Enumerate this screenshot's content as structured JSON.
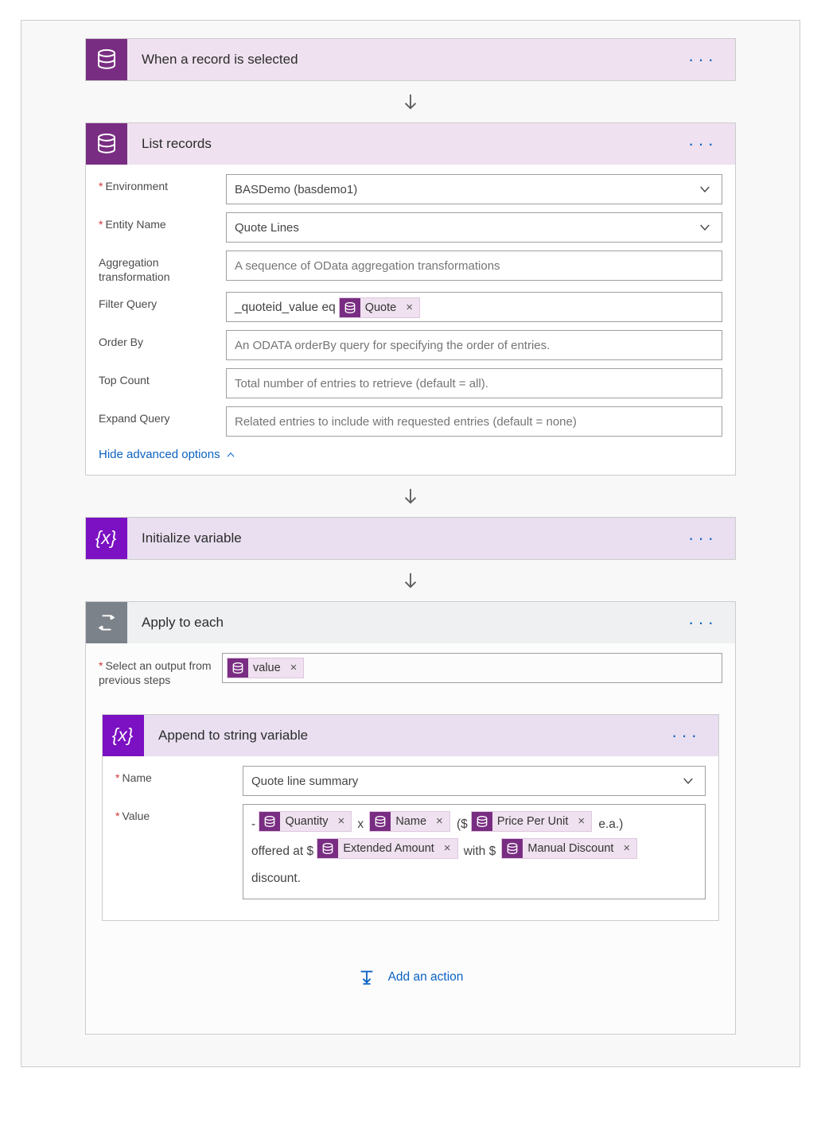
{
  "trigger": {
    "title": "When a record is selected"
  },
  "list_records": {
    "title": "List records",
    "fields": {
      "environment_label": "Environment",
      "environment_value": "BASDemo (basdemo1)",
      "entity_label": "Entity Name",
      "entity_value": "Quote Lines",
      "agg_label": "Aggregation transformation",
      "agg_placeholder": "A sequence of OData aggregation transformations",
      "filter_label": "Filter Query",
      "filter_pretext": "_quoteid_value eq",
      "filter_token": "Quote",
      "orderby_label": "Order By",
      "orderby_placeholder": "An ODATA orderBy query for specifying the order of entries.",
      "top_label": "Top Count",
      "top_placeholder": "Total number of entries to retrieve (default = all).",
      "expand_label": "Expand Query",
      "expand_placeholder": "Related entries to include with requested entries (default = none)"
    },
    "adv_link": "Hide advanced options"
  },
  "init_var": {
    "title": "Initialize variable"
  },
  "apply_each": {
    "title": "Apply to each",
    "select_label": "Select an output from previous steps",
    "select_token": "value",
    "append": {
      "title": "Append to string variable",
      "name_label": "Name",
      "name_value": "Quote line summary",
      "value_label": "Value",
      "text": {
        "dash": " - ",
        "q": "Quantity",
        "x": "x",
        "name": "Name",
        "open": "($",
        "price": "Price Per Unit",
        "ea": "e.a.)",
        "offered": "offered at $",
        "ext": "Extended Amount",
        "with": "with $",
        "manual": "Manual Discount",
        "discount": "discount."
      }
    },
    "add_action": "Add an action"
  }
}
